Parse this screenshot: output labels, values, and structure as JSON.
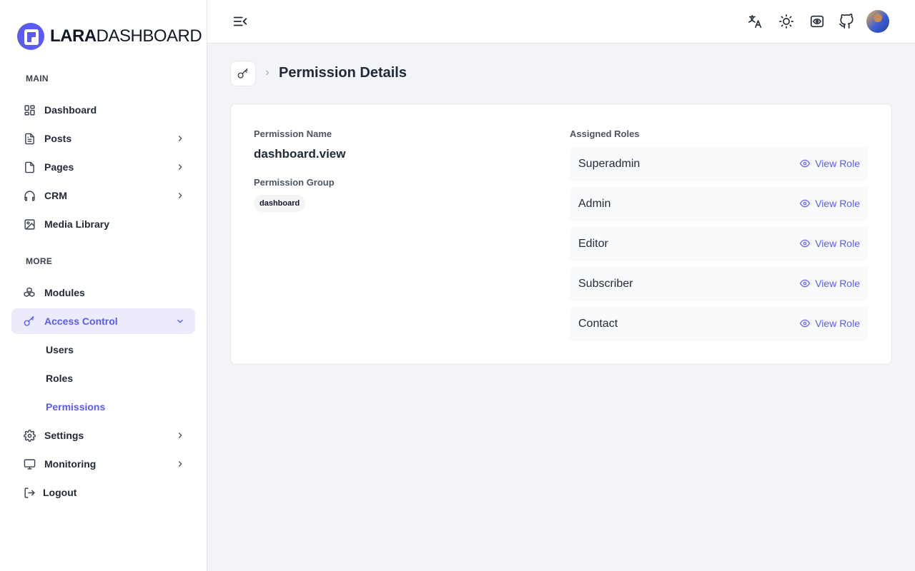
{
  "brand": {
    "bold": "LARA",
    "light": "DASHBOARD"
  },
  "sidebar": {
    "sections": {
      "main": "MAIN",
      "more": "MORE"
    },
    "items": [
      {
        "label": "Dashboard"
      },
      {
        "label": "Posts"
      },
      {
        "label": "Pages"
      },
      {
        "label": "CRM"
      },
      {
        "label": "Media Library"
      },
      {
        "label": "Modules"
      },
      {
        "label": "Access Control"
      },
      {
        "label": "Settings"
      },
      {
        "label": "Monitoring"
      },
      {
        "label": "Logout"
      }
    ],
    "access_sub": [
      {
        "label": "Users"
      },
      {
        "label": "Roles"
      },
      {
        "label": "Permissions"
      }
    ]
  },
  "page": {
    "title": "Permission Details"
  },
  "details": {
    "name_label": "Permission Name",
    "name_value": "dashboard.view",
    "group_label": "Permission Group",
    "group_value": "dashboard",
    "roles_label": "Assigned Roles",
    "view_label": "View Role",
    "roles": [
      {
        "name": "Superadmin"
      },
      {
        "name": "Admin"
      },
      {
        "name": "Editor"
      },
      {
        "name": "Subscriber"
      },
      {
        "name": "Contact"
      }
    ]
  },
  "colors": {
    "accent": "#5b5bf0",
    "active_bg": "#ebebfb",
    "page_bg": "#f3f4f8"
  },
  "icons": {
    "header": [
      "translate-icon",
      "sun-icon",
      "eye-scan-icon",
      "github-icon"
    ],
    "menu_toggle": "menu-collapse-icon"
  }
}
